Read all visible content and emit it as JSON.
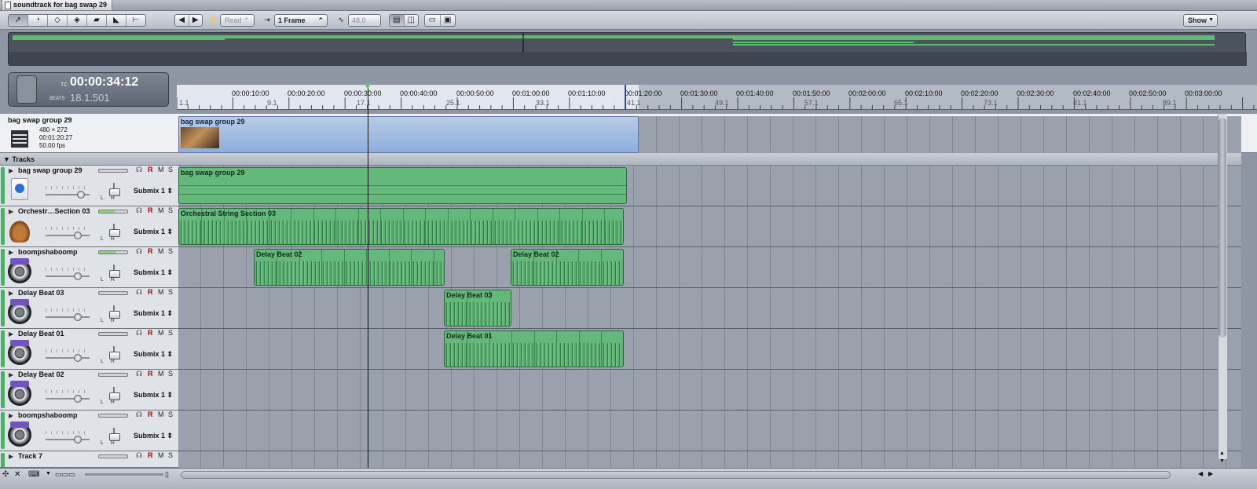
{
  "tab": {
    "title": "soundtrack for bag swap 29"
  },
  "toolbar": {
    "tools": [
      "arrow-tool-icon",
      "timeslice-tool-icon",
      "blade-tool-icon",
      "nudge-tool-icon",
      "lift-tool-icon",
      "scrub-tool-icon",
      "timestretch-tool-icon"
    ],
    "automation_mode": "Read",
    "snap_value": "1 Frame",
    "tempo_value": "48.0",
    "show_button": "Show"
  },
  "transport": {
    "tc_label": "TC",
    "timecode": "00:00:34:12",
    "beats_label": "BEATS",
    "beats": "18.1.501"
  },
  "ruler": {
    "times": [
      "00:00:10:00",
      "00:00:20:00",
      "00:00:30:00",
      "00:00:40:00",
      "00:00:50:00",
      "00:01:00:00",
      "00:01:10:00",
      "00:01:20:00",
      "00:01:30:00",
      "00:01:40:00",
      "00:01:50:00",
      "00:02:00:00",
      "00:02:10:00",
      "00:02:20:00",
      "00:02:30:00",
      "00:02:40:00",
      "00:02:50:00",
      "00:03:00:00"
    ],
    "beats": [
      "1.1",
      "9.1",
      "17.1",
      "25.1",
      "33.1",
      "41.1",
      "49.1",
      "57.1",
      "65.1",
      "73.1",
      "81.1",
      "89.1"
    ]
  },
  "video": {
    "name": "bag swap group 29",
    "size": "480 × 272",
    "duration": "00:01:20:27",
    "fps": "50.00 fps",
    "clip_label": "bag swap group 29"
  },
  "tracks_header": "Tracks",
  "mixer": {
    "r": "R",
    "m": "M",
    "s": "S",
    "submix": "Submix 1",
    "l": "L",
    "rch": "R"
  },
  "tracks": [
    {
      "name": "bag swap group 29",
      "icon": "movie-icon"
    },
    {
      "name": "Orchestr…Section 03",
      "icon": "violin-icon"
    },
    {
      "name": "boompshaboomp",
      "icon": "speaker-icon"
    },
    {
      "name": "Delay Beat 03",
      "icon": "speaker-icon"
    },
    {
      "name": "Delay Beat 01",
      "icon": "speaker-icon"
    },
    {
      "name": "Delay Beat 02",
      "icon": "speaker-icon"
    },
    {
      "name": "boompshaboomp",
      "icon": "speaker-icon"
    },
    {
      "name": "Track 7",
      "icon": "speaker-icon"
    }
  ],
  "clips": {
    "c0": "bag swap group 29",
    "c1": "Orchestral String Section 03",
    "c2a": "Delay Beat 02",
    "c2b": "Delay Beat 02",
    "c3": "Delay Beat 03",
    "c4": "Delay Beat 01"
  },
  "colors": {
    "audio_clip": "#64b87b",
    "video_clip": "#8eaedb",
    "track_color": "#3dbb5b",
    "lane": "#9aa1ad"
  }
}
